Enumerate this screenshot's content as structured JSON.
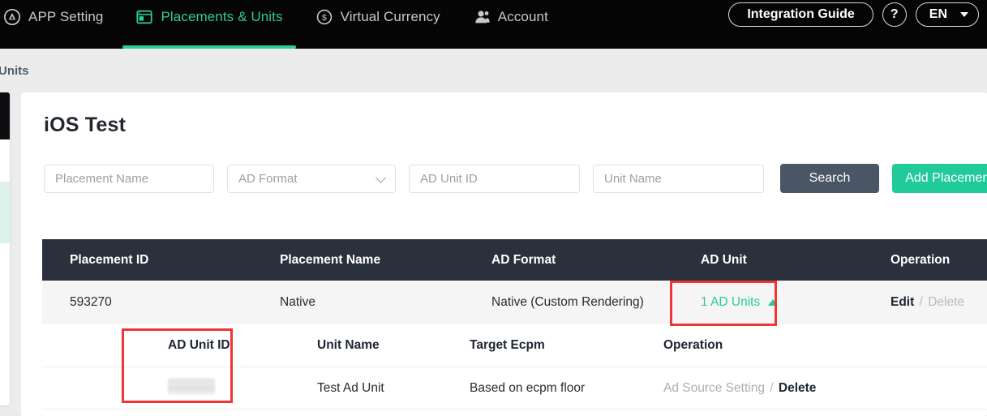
{
  "nav": {
    "items": [
      {
        "label": "APP Setting",
        "icon": "app-store-icon",
        "active": false
      },
      {
        "label": "Placements & Units",
        "icon": "placements-icon",
        "active": true
      },
      {
        "label": "Virtual Currency",
        "icon": "dollar-circle-icon",
        "active": false
      },
      {
        "label": "Account",
        "icon": "user-icon",
        "active": false
      }
    ],
    "integration_guide": "Integration Guide",
    "help": "?",
    "language": "EN",
    "accent_color": "#2ecb9e",
    "bar_color": "#050505"
  },
  "breadcrumb": {
    "text": "Units"
  },
  "page": {
    "title": "iOS Test"
  },
  "filters": {
    "placement_name": {
      "value": "",
      "placeholder": "Placement Name"
    },
    "ad_format": {
      "selected": "AD Format"
    },
    "ad_unit_id": {
      "value": "",
      "placeholder": "AD Unit ID"
    },
    "unit_name": {
      "value": "",
      "placeholder": "Unit Name"
    },
    "search_label": "Search",
    "add_placement_label": "Add Placement",
    "search_color": "#4a5565",
    "add_color": "#21ca99"
  },
  "table": {
    "headers": {
      "placement_id": "Placement ID",
      "placement_name": "Placement Name",
      "ad_format": "AD Format",
      "ad_unit": "AD Unit",
      "operation": "Operation"
    },
    "row": {
      "placement_id": "593270",
      "placement_name": "Native",
      "ad_format": "Native (Custom Rendering)",
      "ad_unit_link": "1 AD Units",
      "ad_unit_caret": "expanded-up",
      "op_edit": "Edit",
      "op_sep": "/",
      "op_delete": "Delete"
    }
  },
  "sub_table": {
    "headers": {
      "ad_unit_id": "AD Unit ID",
      "unit_name": "Unit Name",
      "target_ecpm": "Target Ecpm",
      "operation": "Operation"
    },
    "row": {
      "ad_unit_id": "",
      "unit_name": "Test Ad Unit",
      "target_ecpm": "Based on ecpm floor",
      "op_ad_source": "Ad Source Setting",
      "op_sep": "/",
      "op_delete": "Delete"
    }
  },
  "annotations": {
    "box_color": "#ef3535",
    "box_ad_units": "1 AD Units",
    "box_ad_unit_id": "AD Unit ID"
  }
}
